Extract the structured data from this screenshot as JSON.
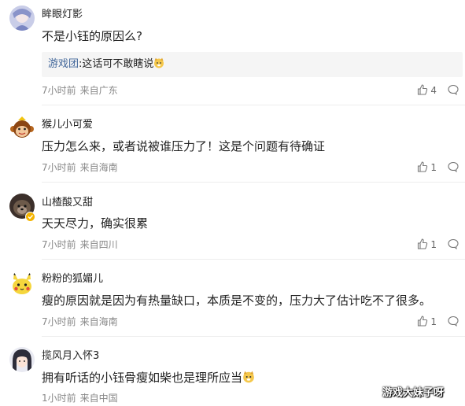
{
  "comments": [
    {
      "username": "眸眼灯影",
      "content": "不是小钰的原因么?",
      "reply": {
        "user": "游戏团",
        "text": ":这话可不敢瞎说"
      },
      "time": "7小时前",
      "location": "来自广东",
      "likes": "4",
      "avatar_icon": "anime-avatar"
    },
    {
      "username": "猴儿小可爱",
      "content": "压力怎么来，或者说被谁压力了！这是个问题有待确证",
      "time": "7小时前",
      "location": "来自海南",
      "likes": "1",
      "avatar_icon": "monkey-avatar"
    },
    {
      "username": "山楂酸又甜",
      "content": "天天尽力，确实很累",
      "time": "7小时前",
      "location": "来自四川",
      "likes": "1",
      "avatar_icon": "dog-avatar"
    },
    {
      "username": "粉粉的狐媚儿",
      "content": "瘦的原因就是因为有热量缺口，本质是不变的，压力大了估计吃不了很多。",
      "time": "7小时前",
      "location": "来自海南",
      "likes": "1",
      "avatar_icon": "pikachu-avatar"
    },
    {
      "username": "揽风月入怀3",
      "content": "拥有听话的小钰骨瘦如柴也是理所应当",
      "time": "1小时前",
      "location": "来自中国",
      "likes": "",
      "avatar_icon": "anime-girl-avatar"
    }
  ],
  "watermark": "游戏大妹子呀",
  "colors": {
    "reply_user": "#406599",
    "meta": "#888888",
    "divider": "#ededed",
    "reply_bg": "#f5f5f5"
  }
}
